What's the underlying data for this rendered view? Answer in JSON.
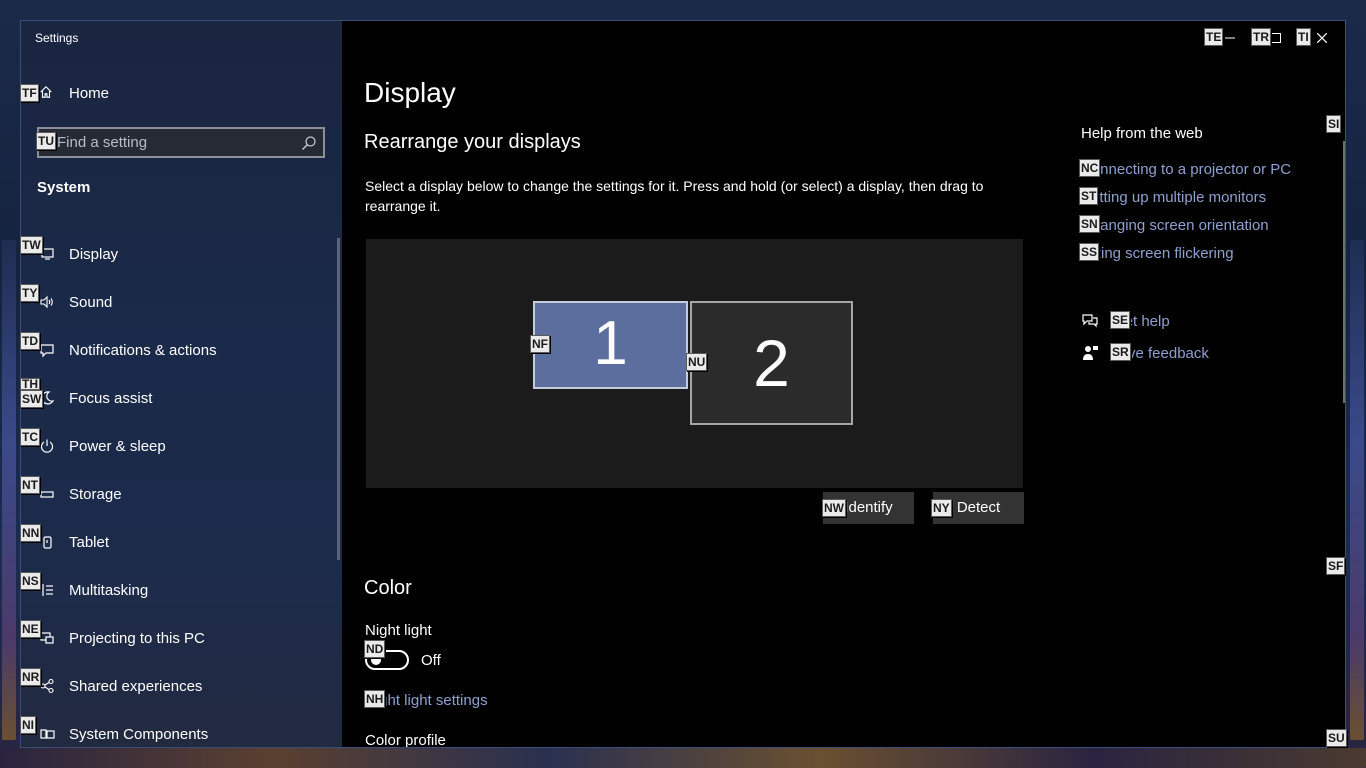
{
  "window": {
    "title": "Settings"
  },
  "sidebar": {
    "home_label": "Home",
    "search_placeholder": "Find a setting",
    "section_heading": "System",
    "items": [
      {
        "label": "Display",
        "icon": "monitor-icon"
      },
      {
        "label": "Sound",
        "icon": "speaker-icon"
      },
      {
        "label": "Notifications & actions",
        "icon": "notification-icon"
      },
      {
        "label": "Focus assist",
        "icon": "moon-icon"
      },
      {
        "label": "Power & sleep",
        "icon": "power-icon"
      },
      {
        "label": "Storage",
        "icon": "storage-icon"
      },
      {
        "label": "Tablet",
        "icon": "tablet-icon"
      },
      {
        "label": "Multitasking",
        "icon": "multitasking-icon"
      },
      {
        "label": "Projecting to this PC",
        "icon": "projecting-icon"
      },
      {
        "label": "Shared experiences",
        "icon": "share-icon"
      },
      {
        "label": "System Components",
        "icon": "components-icon"
      }
    ]
  },
  "main": {
    "page_title": "Display",
    "rearrange": {
      "heading": "Rearrange your displays",
      "description": "Select a display below to change the settings for it. Press and hold (or select) a display, then drag to rearrange it.",
      "monitor_1": "1",
      "monitor_2": "2",
      "identify_label": "Identify",
      "detect_label": "Detect"
    },
    "color": {
      "heading": "Color",
      "night_light_label": "Night light",
      "night_light_state": "Off",
      "night_light_settings_link": "Night light settings",
      "color_profile_label": "Color profile"
    }
  },
  "help": {
    "heading": "Help from the web",
    "links": [
      "Connecting to a projector or PC",
      "Setting up multiple monitors",
      "Changing screen orientation",
      "Fixing screen flickering"
    ],
    "get_help": "Get help",
    "give_feedback": "Give feedback"
  },
  "hints": {
    "minimize": "TE",
    "maximize": "TR",
    "close": "TI",
    "home": "TF",
    "search": "TU",
    "display": "TW",
    "sound": "TY",
    "notifications": "TD",
    "focus_a": "TH",
    "focus_b": "SW",
    "power": "TC",
    "storage": "NT",
    "tablet": "NN",
    "multitasking": "NS",
    "projecting": "NE",
    "shared": "NR",
    "components": "NI",
    "monitor_1": "NF",
    "monitor_2": "NU",
    "identify": "NW",
    "detect": "NY",
    "night_toggle": "ND",
    "night_settings": "NH",
    "help_1": "NC",
    "help_2": "ST",
    "help_3": "SN",
    "help_4": "SS",
    "get_help": "SE",
    "feedback": "SR",
    "scroll_top": "SI",
    "scroll_mid": "SF",
    "scroll_bottom": "SU"
  },
  "colors": {
    "accent_monitor": "#5b6e9e",
    "link": "#8ea0cf",
    "window_border": "#3a4e7a"
  }
}
